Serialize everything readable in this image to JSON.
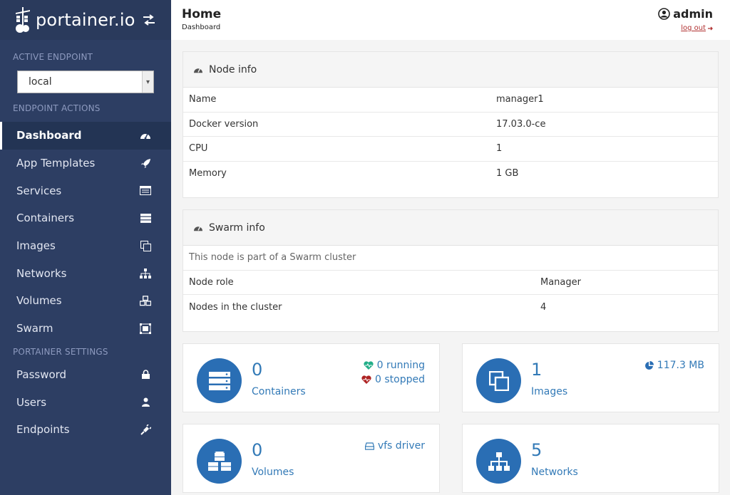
{
  "brand": {
    "name": "portainer.io"
  },
  "sidebar": {
    "active_endpoint_title": "ACTIVE ENDPOINT",
    "endpoint_value": "local",
    "endpoint_actions_title": "ENDPOINT ACTIONS",
    "items": [
      {
        "label": "Dashboard",
        "icon": "dashboard-icon"
      },
      {
        "label": "App Templates",
        "icon": "rocket-icon"
      },
      {
        "label": "Services",
        "icon": "list-alt-icon"
      },
      {
        "label": "Containers",
        "icon": "server-icon"
      },
      {
        "label": "Images",
        "icon": "clone-icon"
      },
      {
        "label": "Networks",
        "icon": "sitemap-icon"
      },
      {
        "label": "Volumes",
        "icon": "cubes-icon"
      },
      {
        "label": "Swarm",
        "icon": "object-group-icon"
      }
    ],
    "settings_title": "PORTAINER SETTINGS",
    "settings_items": [
      {
        "label": "Password",
        "icon": "lock-icon"
      },
      {
        "label": "Users",
        "icon": "user-icon"
      },
      {
        "label": "Endpoints",
        "icon": "plug-icon"
      }
    ]
  },
  "header": {
    "title": "Home",
    "breadcrumb": "Dashboard",
    "user": "admin",
    "logout": "log out"
  },
  "node_info": {
    "title": "Node info",
    "rows": [
      {
        "key": "Name",
        "value": "manager1"
      },
      {
        "key": "Docker version",
        "value": "17.03.0-ce"
      },
      {
        "key": "CPU",
        "value": "1"
      },
      {
        "key": "Memory",
        "value": "1 GB"
      }
    ]
  },
  "swarm_info": {
    "title": "Swarm info",
    "notice": "This node is part of a Swarm cluster",
    "rows": [
      {
        "key": "Node role",
        "value": "Manager"
      },
      {
        "key": "Nodes in the cluster",
        "value": "4"
      }
    ]
  },
  "widgets": {
    "containers": {
      "count": "0",
      "label": "Containers",
      "running": "0 running",
      "stopped": "0 stopped"
    },
    "images": {
      "count": "1",
      "label": "Images",
      "size": "117.3 MB"
    },
    "volumes": {
      "count": "0",
      "label": "Volumes",
      "driver": "vfs driver"
    },
    "networks": {
      "count": "5",
      "label": "Networks"
    }
  },
  "colors": {
    "sidebar": "#2d3e63",
    "accent": "#337ab7",
    "circle": "#2a6eb4",
    "running": "#23ae89",
    "stopped": "#ae2323"
  }
}
